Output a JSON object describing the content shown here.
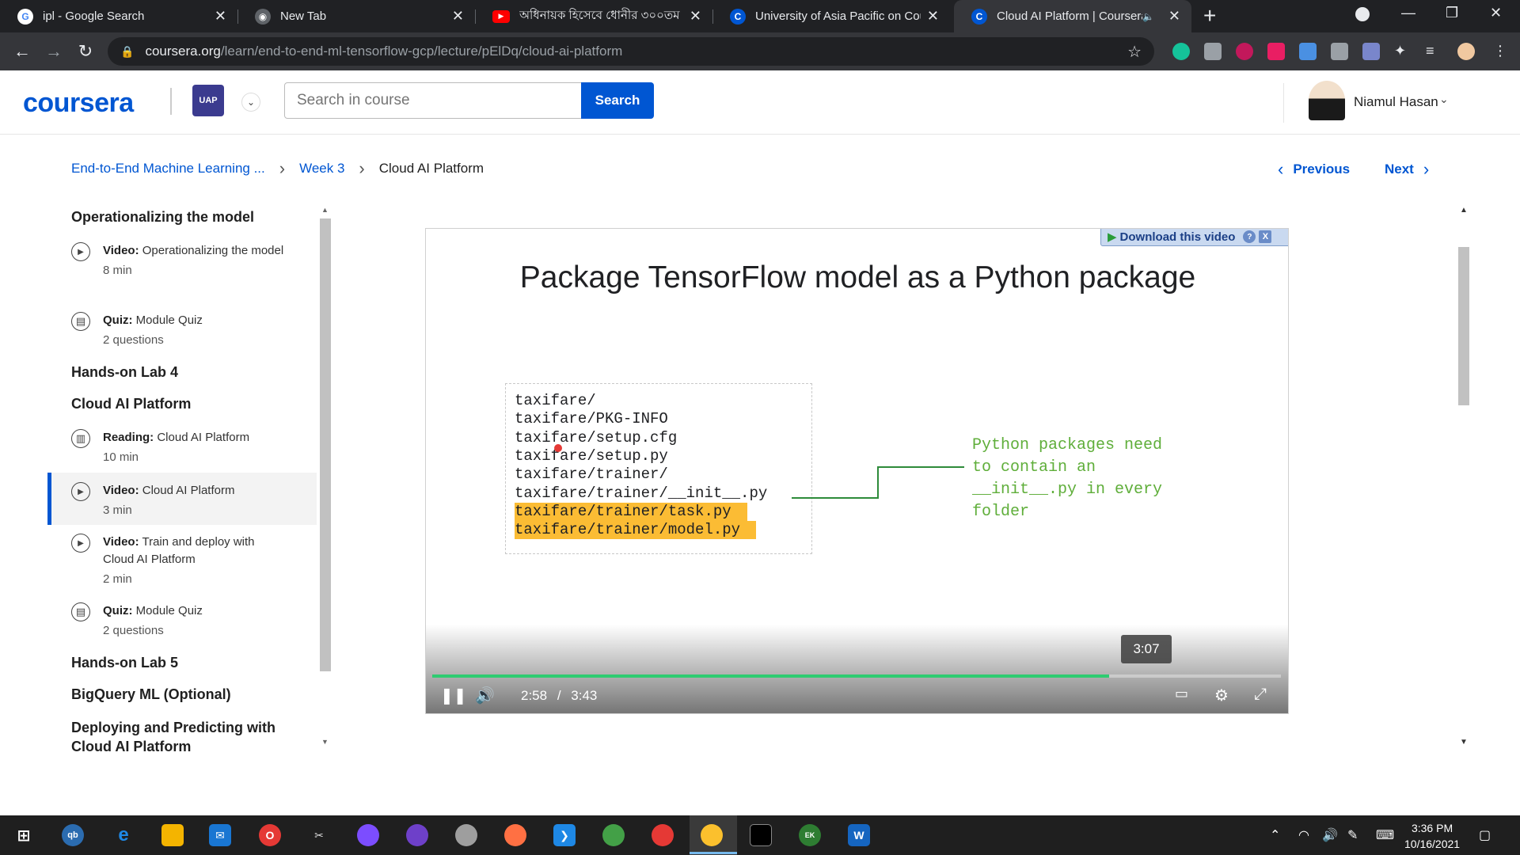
{
  "browser": {
    "tabs": [
      {
        "favicon": "G",
        "title": "ipl - Google Search",
        "active": false
      },
      {
        "favicon": "chrome-icon",
        "title": "New Tab",
        "active": false
      },
      {
        "favicon": "youtube-icon",
        "title": "অধিনায়ক হিসেবে ধোনীর ৩০০তম",
        "active": false
      },
      {
        "favicon": "C",
        "title": "University of Asia Pacific on Cour",
        "active": false
      },
      {
        "favicon": "C",
        "title": "Cloud AI Platform | Coursera",
        "active": true
      }
    ],
    "url_host": "coursera.org",
    "url_path": "/learn/end-to-end-ml-tensorflow-gcp/lecture/pElDq/cloud-ai-platform"
  },
  "header": {
    "logo": "coursera",
    "search_placeholder": "Search in course",
    "search_button": "Search",
    "user_name": "Niamul Hasan"
  },
  "breadcrumb": {
    "course": "End-to-End Machine Learning ...",
    "week": "Week 3",
    "current": "Cloud AI Platform"
  },
  "nav": {
    "previous": "Previous",
    "next": "Next"
  },
  "sidebar": {
    "sections": [
      "Operationalizing the model",
      "Hands-on Lab 4",
      "Cloud AI Platform",
      "Hands-on Lab 5",
      "BigQuery ML (Optional)",
      "Deploying and Predicting with Cloud AI Platform"
    ],
    "items": [
      {
        "type": "Video:",
        "name": "Operationalizing the model",
        "meta": "8 min",
        "icon": "play-icon"
      },
      {
        "type": "Quiz:",
        "name": "Module Quiz",
        "meta": "2 questions",
        "icon": "quiz-icon"
      },
      {
        "type": "Reading:",
        "name": "Cloud AI Platform",
        "meta": "10 min",
        "icon": "reading-icon"
      },
      {
        "type": "Video:",
        "name": "Cloud AI Platform",
        "meta": "3 min",
        "icon": "play-icon",
        "active": true
      },
      {
        "type": "Video:",
        "name": "Train and deploy with Cloud AI Platform",
        "meta": "2 min",
        "icon": "play-icon"
      },
      {
        "type": "Quiz:",
        "name": "Module Quiz",
        "meta": "2 questions",
        "icon": "quiz-icon"
      }
    ]
  },
  "video": {
    "download_label": "Download this video",
    "slide_title": "Package TensorFlow model as a Python package",
    "code_lines": [
      "taxifare/",
      "taxifare/PKG-INFO",
      "taxifare/setup.cfg",
      "taxifare/setup.py",
      "taxifare/trainer/",
      "taxifare/trainer/__init__.py",
      "taxifare/trainer/task.py",
      "taxifare/trainer/model.py"
    ],
    "note": "Python packages need to contain an __init__.py in every folder",
    "hover_time": "3:07",
    "current_time": "2:58",
    "time_sep": "/",
    "duration": "3:43",
    "progress_fraction": 0.798
  },
  "taskbar": {
    "time": "3:36 PM",
    "date": "10/16/2021"
  },
  "colors": {
    "brand": "#0056d2",
    "highlight": "#fbbc34",
    "note_green": "#5fae3a",
    "progress": "#2ecc71"
  }
}
